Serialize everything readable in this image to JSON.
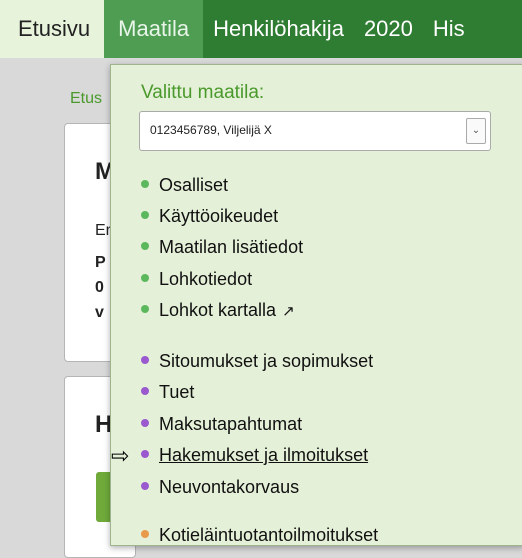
{
  "nav": {
    "items": [
      {
        "label": "Etusivu"
      },
      {
        "label": "Maatila"
      },
      {
        "label": "Henkilöhakija"
      },
      {
        "label": "2020"
      },
      {
        "label": "His"
      }
    ]
  },
  "breadcrumb": "Etus",
  "background": {
    "card1_heading": "M",
    "card1_line1": "Er",
    "card1_line2": "P",
    "card1_line3": "0",
    "card1_line4": "v",
    "card2_heading": "H"
  },
  "dropdown": {
    "title": "Valittu maatila:",
    "selected_farm": "0123456789, Viljelijä X",
    "group1": [
      {
        "label": "Osalliset"
      },
      {
        "label": "Käyttöoikeudet"
      },
      {
        "label": "Maatilan lisätiedot"
      },
      {
        "label": "Lohkotiedot"
      },
      {
        "label": "Lohkot kartalla"
      }
    ],
    "group2": [
      {
        "label": "Sitoumukset ja sopimukset"
      },
      {
        "label": "Tuet"
      },
      {
        "label": "Maksutapahtumat"
      },
      {
        "label": "Hakemukset ja ilmoitukset"
      },
      {
        "label": "Neuvontakorvaus"
      }
    ],
    "partial_item": "Kotieläintuotantoilmoitukset"
  },
  "colors": {
    "nav_bg": "#2e7d32",
    "dropdown_bg": "#e5f0d8",
    "accent_green": "#4a9a2b",
    "dot_green": "#5cb85c",
    "dot_purple": "#9b59d0"
  }
}
